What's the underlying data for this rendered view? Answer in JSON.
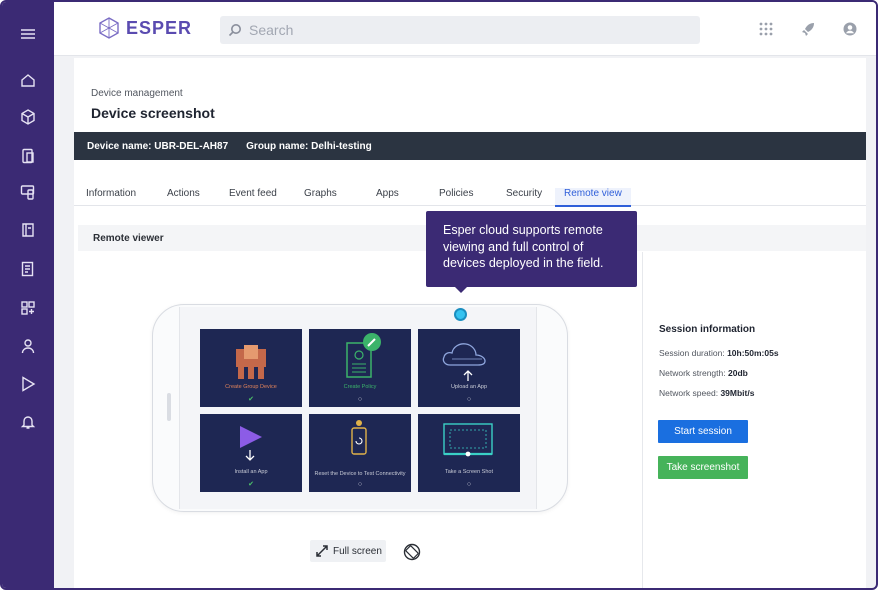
{
  "app": {
    "logo_text": "ESPER"
  },
  "header": {
    "search_placeholder": "Search"
  },
  "sidebar": {
    "items": [
      "menu-icon",
      "home-icon",
      "cube-icon",
      "devices-icon",
      "phone-tablet-icon",
      "book-icon",
      "report-icon",
      "apps-grid-icon",
      "user-icon",
      "play-store-icon",
      "alert-bell-icon"
    ]
  },
  "page": {
    "breadcrumb": "Device management",
    "title": "Device screenshot",
    "device_name": "Device name: UBR-DEL-AH87",
    "group_name": "Group name: Delhi-testing"
  },
  "tabs": [
    {
      "label": "Information",
      "active": false
    },
    {
      "label": "Actions",
      "active": false
    },
    {
      "label": "Event feed",
      "active": false
    },
    {
      "label": "Graphs",
      "active": false
    },
    {
      "label": "Apps",
      "active": false
    },
    {
      "label": "Policies",
      "active": false
    },
    {
      "label": "Security",
      "active": false
    },
    {
      "label": "Remote view",
      "active": true
    }
  ],
  "section": {
    "title": "Remote viewer"
  },
  "tooltip": {
    "text": "Esper cloud supports remote viewing and full control of devices deployed in the field."
  },
  "tiles": [
    {
      "label": "Create Group Device",
      "status": "check",
      "icon": "group-device-icon"
    },
    {
      "label": "Create Policy",
      "status": "ring",
      "icon": "policy-icon"
    },
    {
      "label": "Upload an App",
      "status": "ring",
      "icon": "cloud-upload-icon"
    },
    {
      "label": "Install an App",
      "status": "check",
      "icon": "install-app-icon"
    },
    {
      "label": "Reset the Device to Test Connectivity",
      "status": "ring",
      "icon": "reset-device-icon"
    },
    {
      "label": "Take a Screen Shot",
      "status": "ring",
      "icon": "screenshot-icon"
    }
  ],
  "controls": {
    "fullscreen_label": "Full screen"
  },
  "session": {
    "title": "Session information",
    "duration_label": "Session duration:",
    "duration_value": "10h:50m:05s",
    "strength_label": "Network strength:",
    "strength_value": "20db",
    "speed_label": "Network speed:",
    "speed_value": "39Mbit/s",
    "start_button": "Start session",
    "screenshot_button": "Take screenshot"
  },
  "colors": {
    "sidebar": "#3b2a74",
    "accent_blue": "#1a6fe0",
    "accent_green": "#46b35a",
    "device_bar": "#2b3441",
    "tile_bg": "#1e2753"
  }
}
